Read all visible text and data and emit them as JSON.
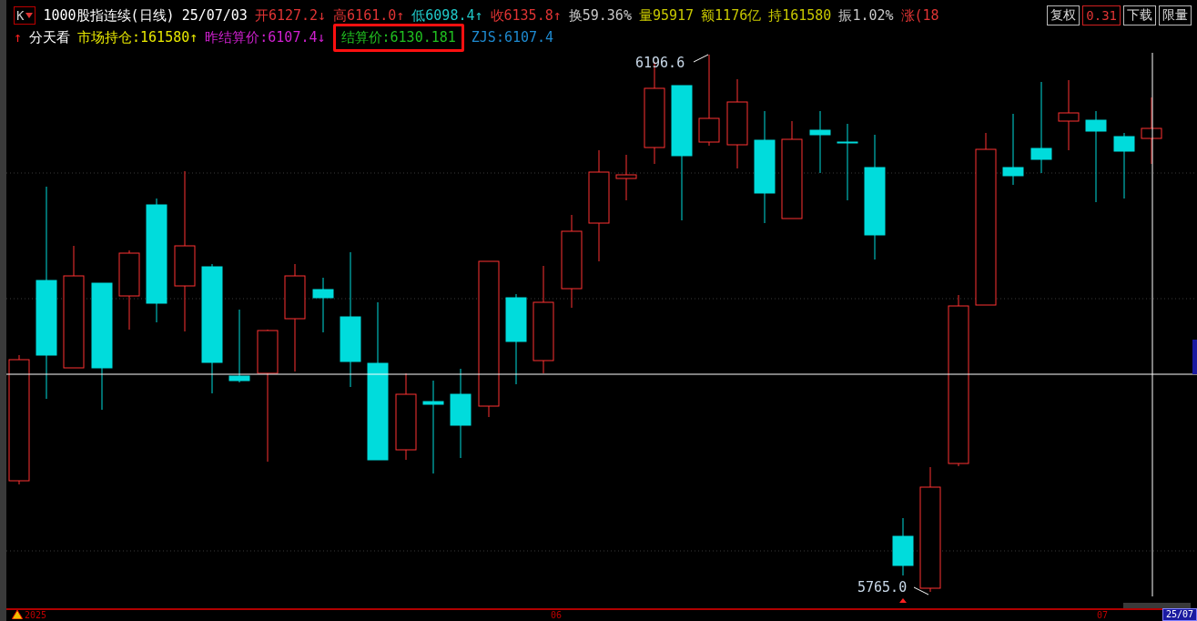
{
  "header": {
    "period_button": "K",
    "title": "1000股指连续(日线)",
    "date": "25/07/03",
    "quotes": [
      {
        "text": "开6127.2↓",
        "color": "#e03434"
      },
      {
        "text": "高6161.0↑",
        "color": "#e03434"
      },
      {
        "text": "低6098.4↑",
        "color": "#20c8c8"
      },
      {
        "text": "收6135.8↑",
        "color": "#e03434"
      },
      {
        "text": "换59.36%",
        "color": "#c8c8c8"
      },
      {
        "text": "量95917",
        "color": "#c8c800"
      },
      {
        "text": "额1176亿",
        "color": "#c8c800"
      },
      {
        "text": "持161580",
        "color": "#c8c800"
      },
      {
        "text": "振1.02%",
        "color": "#c8c8c8"
      },
      {
        "text": "涨(18",
        "color": "#e03434"
      }
    ],
    "buttons": [
      {
        "label": "复权",
        "selected": false
      },
      {
        "label": "0.31",
        "selected": true
      },
      {
        "label": "下载",
        "selected": false
      },
      {
        "label": "限量",
        "selected": false
      }
    ]
  },
  "info_row": [
    {
      "text": "↑",
      "color": "#ff2020"
    },
    {
      "text": "分天看",
      "color": "#ffffff"
    },
    {
      "text": "市场持仓:161580↑",
      "color": "#e8e800"
    },
    {
      "text": "昨结算价:6107.4↓",
      "color": "#d020d0"
    },
    {
      "text": "结算价:6130.181",
      "color": "#20c020",
      "highlighted": true
    },
    {
      "text": "ZJS:6107.4",
      "color": "#1e8ad0"
    }
  ],
  "chart": {
    "high_label": "6196.6",
    "low_label": "5765.0",
    "axis_labels": [
      {
        "text": "2025"
      },
      {
        "text": "06"
      },
      {
        "text": "07"
      }
    ],
    "cursor_date": "25/07"
  }
}
